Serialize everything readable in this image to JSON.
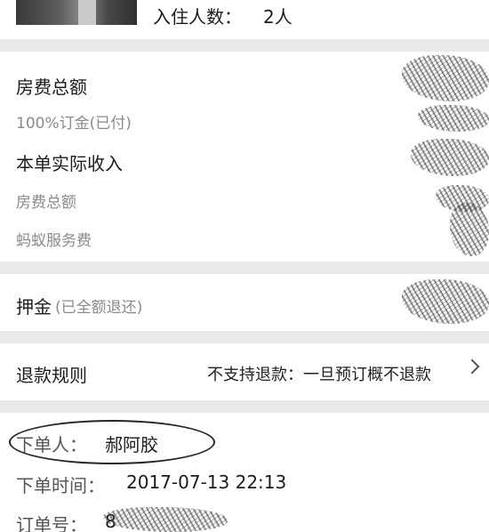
{
  "guest": {
    "count_label": "入住人数：",
    "count_value": "2人"
  },
  "fees": {
    "room_total_label": "房费总额",
    "deposit_percent_label": "100%订金(已付)",
    "actual_income_label": "本单实际收入",
    "room_total_sub_label": "房费总额",
    "service_fee_label": "蚂蚁服务费"
  },
  "deposit": {
    "label": "押金",
    "status": "(已全额退还)"
  },
  "refund": {
    "label": "退款规则",
    "value": "不支持退款：一旦预订概不退款"
  },
  "order": {
    "orderer_label": "下单人：",
    "orderer_name": "郝阿胶",
    "time_label": "下单时间：",
    "time_value": "2017-07-13 22:13",
    "number_label": "订单号：",
    "number_visible": "8"
  },
  "icons": {
    "refund_arrow": "chevron-right-icon"
  }
}
